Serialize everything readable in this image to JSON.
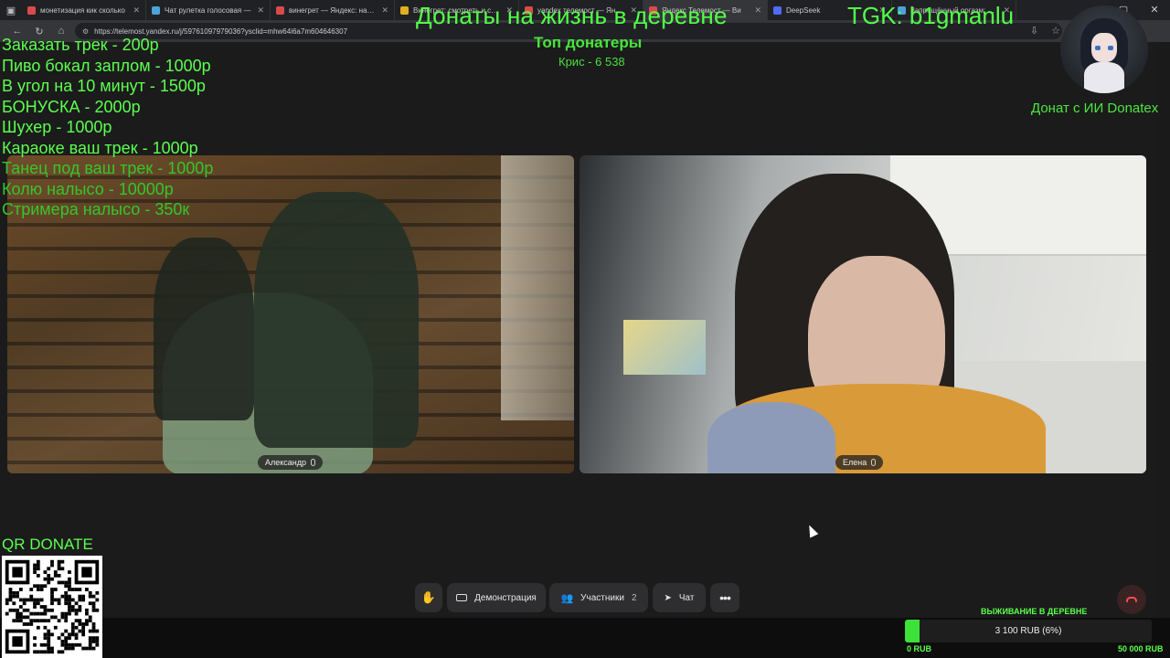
{
  "browser": {
    "tabs": [
      {
        "title": "монетизация кик сколько",
        "color": "#d94b4b"
      },
      {
        "title": "Чат рулетка голосовая —",
        "color": "#4ba3d9"
      },
      {
        "title": "винегрет — Яндекс: нашл",
        "color": "#d94b4b"
      },
      {
        "title": "Винегрет: смотреть и скач",
        "color": "#e0b020"
      },
      {
        "title": "yandex телемост — Яндек",
        "color": "#d94b4b"
      },
      {
        "title": "Яндекс Телемост — Ви",
        "color": "#d94b4b"
      },
      {
        "title": "DeepSeek",
        "color": "#4d6bfe"
      },
      {
        "title": "Запрещённый оргазм: пол",
        "color": "#4ba3d9"
      }
    ],
    "url": "https://telemost.yandex.ru/j/59761097979036?ysclid=mhw64i6a7m604646307"
  },
  "overlay": {
    "headline": "Донаты на жизнь в деревне",
    "tgk": "TGK: b1gmanlu",
    "top_donors_title": "Топ донатеры",
    "top_donor": "Крис - 6 538",
    "ai_donate": "Донат с ИИ Donatex",
    "price_list": [
      "Заказать трек - 200р",
      "Пиво бокал заплом - 1000р",
      "В угол на 10 минут - 1500р",
      "БОНУСКА - 2000р",
      "Шухер - 1000р",
      "Караоке ваш трек - 1000р",
      "Танец под ваш трек - 1000р",
      "Колю налысо - 10000р",
      "Стримера налысо - 350к"
    ],
    "qr_label": "QR DONATE"
  },
  "participants": [
    {
      "name": "Александр"
    },
    {
      "name": "Елена"
    }
  ],
  "toolbar": {
    "demo_label": "Демонстрация",
    "participants_label": "Участники",
    "participants_count": "2",
    "chat_label": "Чат"
  },
  "goal": {
    "title": "ВЫЖИВАНИЕ В ДЕРЕВНЕ",
    "progress_text": "3 100 RUB (6%)",
    "progress_fraction": 0.06,
    "min_label": "0 RUB",
    "max_label": "50 000 RUB",
    "fill_color": "#3ee03a"
  },
  "icons": {
    "hand": "raise-hand-icon",
    "screen": "screen-share-icon",
    "people": "participants-icon",
    "chat": "send-icon",
    "more": "more-icon",
    "hangup": "hangup-icon"
  }
}
